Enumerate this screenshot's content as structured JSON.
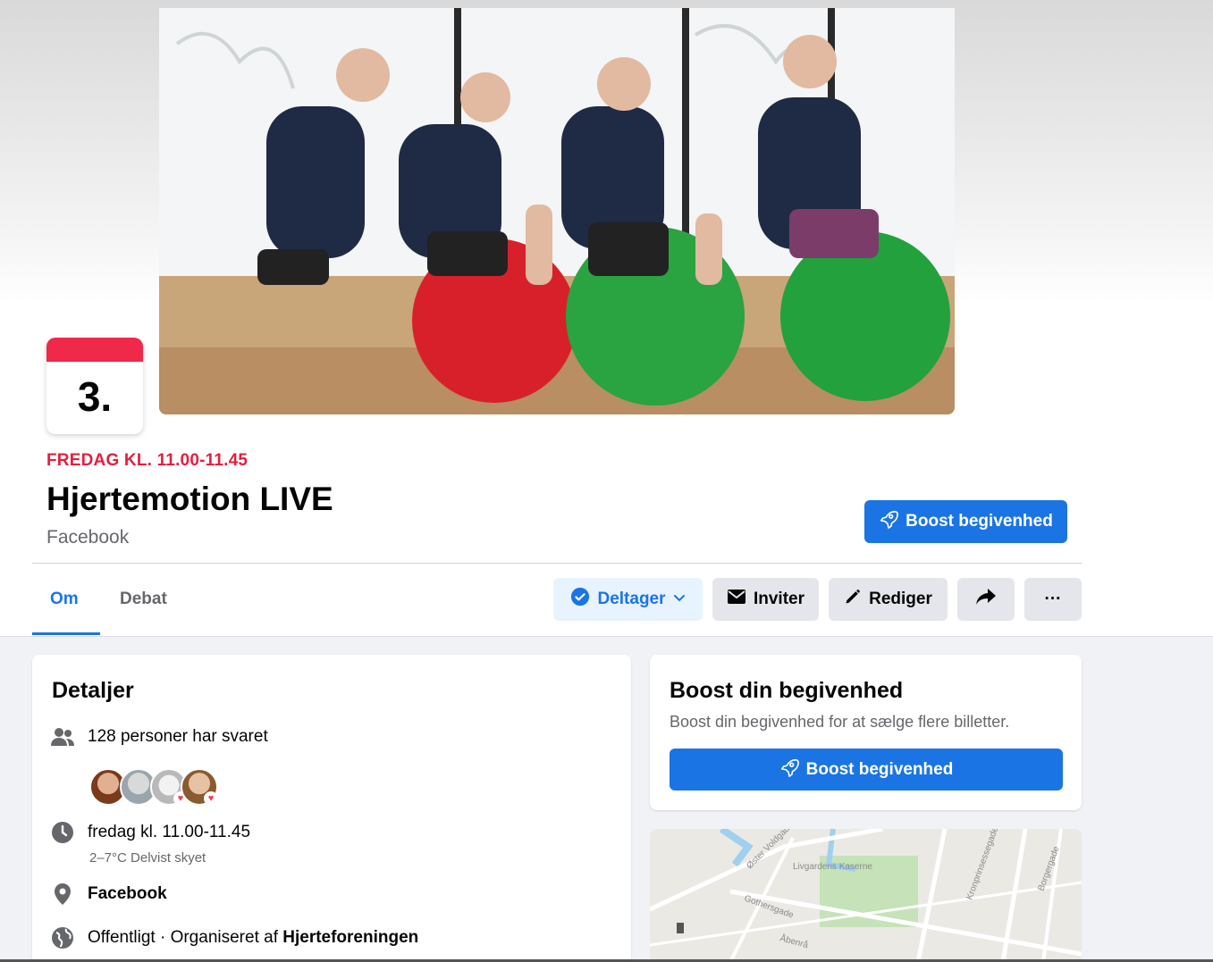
{
  "header": {
    "date_day": "3.",
    "date_line": "FREDAG KL. 11.00-11.45",
    "title": "Hjertemotion LIVE",
    "location": "Facebook",
    "boost_button": "Boost begivenhed"
  },
  "tabs": [
    {
      "label": "Om",
      "active": true
    },
    {
      "label": "Debat",
      "active": false
    }
  ],
  "actions": {
    "going": "Deltager",
    "invite": "Inviter",
    "edit": "Rediger",
    "more": "···"
  },
  "details": {
    "heading": "Detaljer",
    "responses": "128 personer har svaret",
    "time": "fredag kl. 11.00-11.45",
    "weather": "2–7°C Delvist skyet",
    "place": "Facebook",
    "privacy_prefix": "Offentligt · Organiseret af ",
    "organizer": "Hjerteforeningen"
  },
  "boost_card": {
    "heading": "Boost din begivenhed",
    "text": "Boost din begivenhed for at sælge flere billetter.",
    "button": "Boost begivenhed"
  },
  "map_labels": [
    "Øster Voldgade",
    "Livgardens Kaserne",
    "Gothersgade",
    "Kronprinsessegade",
    "Borgergade",
    "Åbenrå"
  ],
  "colors": {
    "accent": "#1b74e4",
    "date_red": "#e41e3f",
    "calendar_band": "#f02849",
    "secondary_bg": "#e4e6eb",
    "page_bg": "#f0f2f5"
  }
}
